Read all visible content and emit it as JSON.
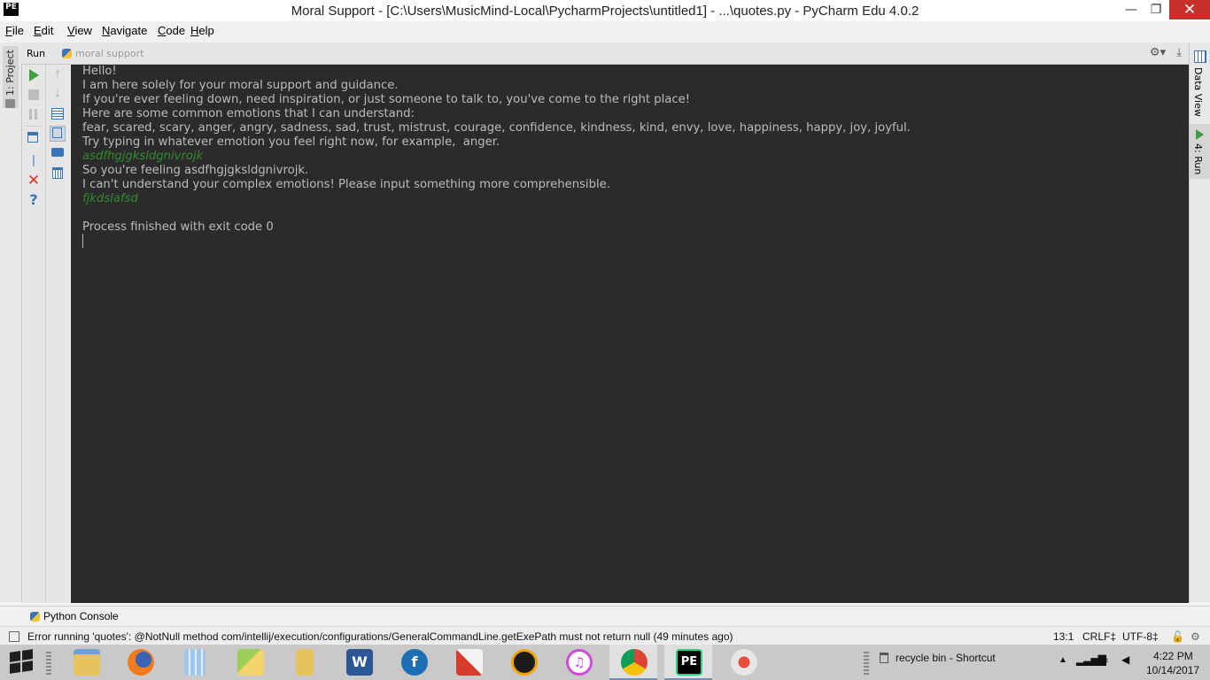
{
  "window": {
    "logo": "PE",
    "title": "Moral Support - [C:\\Users\\MusicMind-Local\\PycharmProjects\\untitled1] - ...\\quotes.py - PyCharm Edu 4.0.2",
    "minimize": "—",
    "maximize": "❐",
    "close": "✕"
  },
  "menu": [
    "File",
    "Edit",
    "View",
    "Navigate",
    "Code",
    "Help"
  ],
  "left_tab": {
    "label": "1: Project"
  },
  "right_tabs": {
    "data_view": "Data View",
    "run": "4: Run"
  },
  "run_panel": {
    "label": "Run",
    "config": "moral support",
    "console_lines": [
      {
        "text": "Hello!",
        "kind": "out"
      },
      {
        "text": "I am here solely for your moral support and guidance.",
        "kind": "out"
      },
      {
        "text": "If you're ever feeling down, need inspiration, or just someone to talk to, you've come to the right place!",
        "kind": "out"
      },
      {
        "text": "Here are some common emotions that I can understand:",
        "kind": "out"
      },
      {
        "text": "fear, scared, scary, anger, angry, sadness, sad, trust, mistrust, courage, confidence, kindness, kind, envy, love, happiness, happy, joy, joyful.",
        "kind": "out"
      },
      {
        "text": "Try typing in whatever emotion you feel right now, for example,  anger.",
        "kind": "out"
      },
      {
        "text": "asdfhgjgksldgnivrojk",
        "kind": "in"
      },
      {
        "text": "So you're feeling asdfhgjgksldgnivrojk.",
        "kind": "out"
      },
      {
        "text": "I can't understand your complex emotions! Please input something more comprehensible.",
        "kind": "out"
      },
      {
        "text": "fjkdslafsd",
        "kind": "in"
      },
      {
        "text": "",
        "kind": "out"
      },
      {
        "text": "Process finished with exit code 0",
        "kind": "out"
      }
    ]
  },
  "python_console": {
    "label": "Python Console"
  },
  "status": {
    "message": "Error running 'quotes': @NotNull method com/intellij/execution/configurations/GeneralCommandLine.getExePath must not return null (49 minutes ago)",
    "position": "13:1",
    "line_sep": "CRLF‡",
    "encoding": "UTF-8‡"
  },
  "taskbar": {
    "apps": [
      "file-explorer",
      "firefox",
      "calculator",
      "photos",
      "folder",
      "word",
      "filezilla",
      "ccleaner",
      "aimp",
      "itunes",
      "chrome",
      "pycharm-edu",
      "snipping-tool"
    ],
    "tray_shortcut": "recycle bin - Shortcut",
    "time": "4:22 PM",
    "date": "10/14/2017"
  },
  "colors": {
    "console_bg": "#2b2b2b",
    "console_text": "#bbbbbb",
    "user_input": "#2e8b2e",
    "run_green": "#3c9e3c",
    "stop_red": "#d9342b"
  }
}
